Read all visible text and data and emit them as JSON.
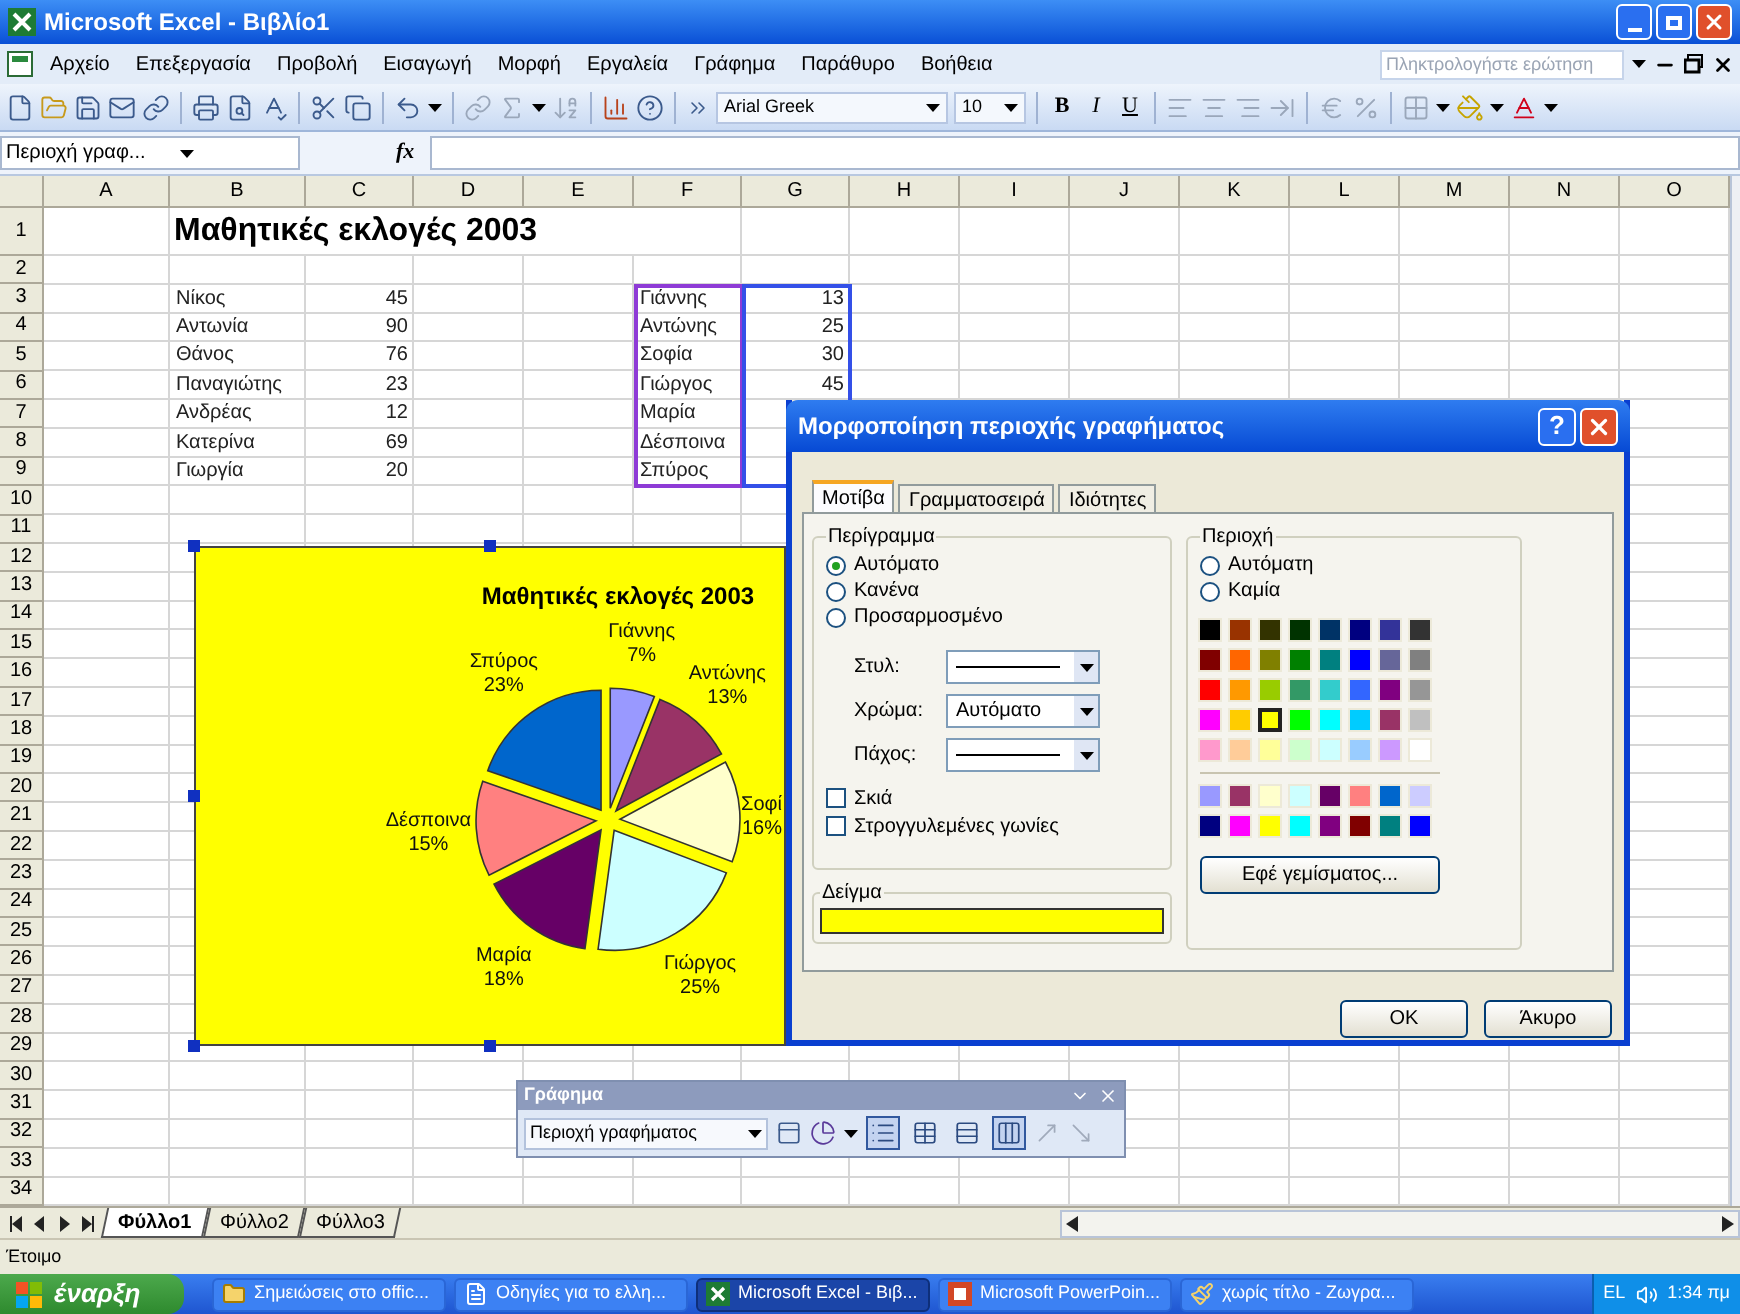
{
  "window": {
    "title": "Microsoft Excel - Βιβλίο1"
  },
  "menu": [
    "Αρχείο",
    "Επεξεργασία",
    "Προβολή",
    "Εισαγωγή",
    "Μορφή",
    "Εργαλεία",
    "Γράφημα",
    "Παράθυρο",
    "Βοήθεια"
  ],
  "question_box": {
    "placeholder": "Πληκτρολογήστε ερώτηση"
  },
  "toolbar": {
    "font": "Arial Greek",
    "font_size": "10",
    "style_buttons": [
      "B",
      "I",
      "U"
    ]
  },
  "formula_bar": {
    "name_box": "Περιοχή γραφ...",
    "function_label": "fx"
  },
  "sheet": {
    "columns": [
      "A",
      "B",
      "C",
      "D",
      "E",
      "F",
      "G",
      "H",
      "I",
      "J",
      "K",
      "L",
      "M",
      "N",
      "O"
    ],
    "row_numbers": [
      "1",
      "2",
      "3",
      "4",
      "5",
      "6",
      "7",
      "8",
      "9",
      "10",
      "11",
      "12",
      "13",
      "14",
      "15",
      "16",
      "17",
      "18",
      "19",
      "20",
      "21",
      "22",
      "23",
      "24",
      "25",
      "26",
      "27",
      "28",
      "29",
      "30",
      "31",
      "32",
      "33",
      "34"
    ],
    "title": "Μαθητικές εκλογές 2003",
    "list_1": [
      {
        "name": "Νίκος",
        "value": "45"
      },
      {
        "name": "Αντωνία",
        "value": "90"
      },
      {
        "name": "Θάνος",
        "value": "76"
      },
      {
        "name": "Παναγιώτης",
        "value": "23"
      },
      {
        "name": "Ανδρέας",
        "value": "12"
      },
      {
        "name": "Κατερίνα",
        "value": "69"
      },
      {
        "name": "Γιωργία",
        "value": "20"
      }
    ],
    "list_2": [
      {
        "name": "Γιάννης",
        "value": "13"
      },
      {
        "name": "Αντώνης",
        "value": "25"
      },
      {
        "name": "Σοφία",
        "value": "30"
      },
      {
        "name": "Γιώργος",
        "value": "45"
      },
      {
        "name": "Μαρία"
      },
      {
        "name": "Δέσποινα"
      },
      {
        "name": "Σπύρος"
      }
    ]
  },
  "chart": {
    "chart_data": {
      "type": "pie",
      "title": "Μαθητικές εκλογές 2003",
      "categories": [
        "Γιάννης",
        "Αντώνης",
        "Σοφί",
        "Γιώργος",
        "Μαρία",
        "Δέσποινα",
        "Σπύρος"
      ],
      "values": [
        7,
        13,
        16,
        25,
        18,
        15,
        23
      ],
      "colors": [
        "#9999ff",
        "#993366",
        "#ffffcc",
        "#ccffff",
        "#660066",
        "#ff8080",
        "#0066cc"
      ],
      "value_labels": [
        "7%",
        "13%",
        "16%",
        "25%",
        "18%",
        "15%",
        "23%"
      ]
    }
  },
  "format_dialog": {
    "title": "Μορφοποίηση περιοχής γραφήματος",
    "help_button": "?",
    "tabs": [
      {
        "label": "Μοτίβα",
        "selected": true
      },
      {
        "label": "Γραμματοσειρά",
        "selected": false
      },
      {
        "label": "Ιδιότητες",
        "selected": false
      }
    ],
    "border": {
      "label": "Περίγραμμα",
      "options": [
        {
          "label": "Αυτόματο",
          "selected": true
        },
        {
          "label": "Κανένα",
          "selected": false
        },
        {
          "label": "Προσαρμοσμένο",
          "selected": false
        }
      ],
      "style_label": "Στυλ:",
      "color_label": "Χρώμα:",
      "color_value": "Αυτόματο",
      "weight_label": "Πάχος:",
      "checkboxes": [
        {
          "label": "Σκιά",
          "checked": false
        },
        {
          "label": "Στρογγυλεμένες γωνίες",
          "checked": false
        }
      ]
    },
    "sample_label": "Δείγμα",
    "area": {
      "label": "Περιοχή",
      "options": [
        {
          "label": "Αυτόματη",
          "selected": false
        },
        {
          "label": "Καμία",
          "selected": false
        }
      ],
      "palette": [
        {
          "color": "#000000",
          "selected": false
        },
        {
          "color": "#993300",
          "selected": false
        },
        {
          "color": "#333300",
          "selected": false
        },
        {
          "color": "#003300",
          "selected": false
        },
        {
          "color": "#003366",
          "selected": false
        },
        {
          "color": "#000080",
          "selected": false
        },
        {
          "color": "#333399",
          "selected": false
        },
        {
          "color": "#333333",
          "selected": false
        },
        {
          "color": "#800000",
          "selected": false
        },
        {
          "color": "#ff6600",
          "selected": false
        },
        {
          "color": "#808000",
          "selected": false
        },
        {
          "color": "#008000",
          "selected": false
        },
        {
          "color": "#008080",
          "selected": false
        },
        {
          "color": "#0000ff",
          "selected": false
        },
        {
          "color": "#666699",
          "selected": false
        },
        {
          "color": "#808080",
          "selected": false
        },
        {
          "color": "#ff0000",
          "selected": false
        },
        {
          "color": "#ff9900",
          "selected": false
        },
        {
          "color": "#99cc00",
          "selected": false
        },
        {
          "color": "#339966",
          "selected": false
        },
        {
          "color": "#33cccc",
          "selected": false
        },
        {
          "color": "#3366ff",
          "selected": false
        },
        {
          "color": "#800080",
          "selected": false
        },
        {
          "color": "#969696",
          "selected": false
        },
        {
          "color": "#ff00ff",
          "selected": false
        },
        {
          "color": "#ffcc00",
          "selected": false
        },
        {
          "color": "#ffff00",
          "selected": true
        },
        {
          "color": "#00ff00",
          "selected": false
        },
        {
          "color": "#00ffff",
          "selected": false
        },
        {
          "color": "#00ccff",
          "selected": false
        },
        {
          "color": "#993366",
          "selected": false
        },
        {
          "color": "#c0c0c0",
          "selected": false
        },
        {
          "color": "#ff99cc",
          "selected": false
        },
        {
          "color": "#ffcc99",
          "selected": false
        },
        {
          "color": "#ffff99",
          "selected": false
        },
        {
          "color": "#ccffcc",
          "selected": false
        },
        {
          "color": "#ccffff",
          "selected": false
        },
        {
          "color": "#99ccff",
          "selected": false
        },
        {
          "color": "#cc99ff",
          "selected": false
        },
        {
          "color": "#ffffff",
          "selected": false
        }
      ],
      "extra_palette": [
        {
          "color": "#9999ff",
          "selected": false
        },
        {
          "color": "#993366",
          "selected": false
        },
        {
          "color": "#ffffcc",
          "selected": false
        },
        {
          "color": "#ccffff",
          "selected": false
        },
        {
          "color": "#660066",
          "selected": false
        },
        {
          "color": "#ff8080",
          "selected": false
        },
        {
          "color": "#0066cc",
          "selected": false
        },
        {
          "color": "#ccccff",
          "selected": false
        },
        {
          "color": "#000080",
          "selected": false
        },
        {
          "color": "#ff00ff",
          "selected": false
        },
        {
          "color": "#ffff00",
          "selected": false
        },
        {
          "color": "#00ffff",
          "selected": false
        },
        {
          "color": "#800080",
          "selected": false
        },
        {
          "color": "#800000",
          "selected": false
        },
        {
          "color": "#008080",
          "selected": false
        },
        {
          "color": "#0000ff",
          "selected": false
        }
      ],
      "fill_effects": "Εφέ γεμίσματος..."
    },
    "buttons": [
      "OK",
      "Άκυρο"
    ]
  },
  "chart_toolbar": {
    "title": "Γράφημα",
    "object_box": "Περιοχή γραφήματος",
    "toggles": [
      {
        "kind": "legend",
        "on": true
      },
      {
        "kind": "data_table",
        "on": false
      },
      {
        "kind": "by_row",
        "on": false
      },
      {
        "kind": "by_column",
        "on": true
      }
    ]
  },
  "sheet_tabs": [
    {
      "label": "Φύλλο1",
      "selected": true
    },
    {
      "label": "Φύλλο2",
      "selected": false
    },
    {
      "label": "Φύλλο3",
      "selected": false
    }
  ],
  "status_bar": "Έτοιμο",
  "taskbar": {
    "start": "έναρξη",
    "items": [
      {
        "kind": "folder",
        "label": "Σημειώσεις στο offic...",
        "selected": false
      },
      {
        "kind": "document",
        "label": "Οδηγίες για το ελλη...",
        "selected": false
      },
      {
        "kind": "excel",
        "label": "Microsoft Excel - Βιβ...",
        "selected": true
      },
      {
        "kind": "powerpoint",
        "label": "Microsoft PowerPoin...",
        "selected": false
      },
      {
        "kind": "paint",
        "label": "χωρίς τίτλο - Ζωγρα...",
        "selected": false
      }
    ],
    "language": "EL",
    "clock": "1:34 πμ"
  }
}
